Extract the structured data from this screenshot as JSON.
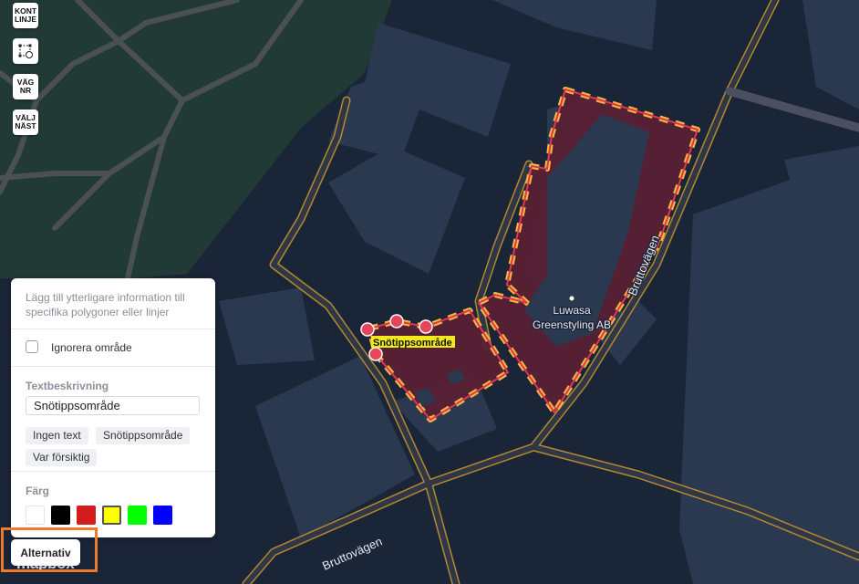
{
  "toolbar": {
    "buttons": [
      {
        "id": "kontlinje",
        "label": "KONT\nLINJE"
      },
      {
        "id": "polygon",
        "label": "",
        "icon": "polygon-edit-icon"
      },
      {
        "id": "vagnr",
        "label": "VÄG\nNR"
      },
      {
        "id": "valjnast",
        "label": "VÄLJ\nNÄST"
      }
    ]
  },
  "map": {
    "street_labels": [
      "Bruttovägen",
      "Bruttovägen"
    ],
    "poi": {
      "name_line1": "Luwasa",
      "name_line2": "Greenstyling AB"
    },
    "polygon_label": "Snötippsområde",
    "colors": {
      "background": "#1b2538",
      "park": "#223a36",
      "building": "#2a3950",
      "road": "#2f3747",
      "road_outline": "#b3882e",
      "polygon_fill": "#5a1f33",
      "polygon_stroke": "#e0374f",
      "polygon_dash": "#f5b942",
      "vertex": "#e8455a",
      "label_bg": "#f2ea1a"
    }
  },
  "panel": {
    "intro": "Lägg till ytterligare information till specifika polygoner eller linjer",
    "ignore_label": "Ignorera område",
    "ignore_checked": false,
    "text_section_title": "Textbeskrivning",
    "text_value": "Snötippsområde",
    "presets": [
      "Ingen text",
      "Snötippsområde",
      "Var försiktig"
    ],
    "color_section_title": "Färg",
    "colors": [
      "#ffffff",
      "#000000",
      "#d41c1c",
      "#ffff00",
      "#00ff00",
      "#0000ff"
    ],
    "selected_color": "#ffff00"
  },
  "alt_button": "Alternativ",
  "attribution": "mapbox"
}
